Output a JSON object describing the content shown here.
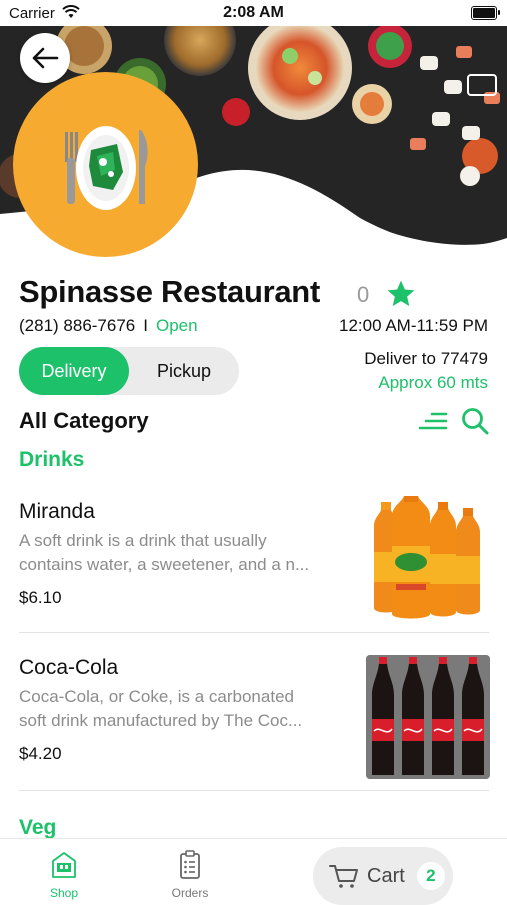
{
  "status_bar": {
    "carrier": "Carrier",
    "time": "2:08 AM"
  },
  "restaurant": {
    "name": "Spinasse Restaurant",
    "rating_count": "0",
    "phone": "(281) 886-7676",
    "separator": "I",
    "status": "Open",
    "hours": "12:00 AM-11:59 PM"
  },
  "order_mode": {
    "delivery_label": "Delivery",
    "pickup_label": "Pickup",
    "selected": "Delivery"
  },
  "delivery": {
    "deliver_to": "Deliver to 77479",
    "approx": "Approx 60 mts"
  },
  "category_header": "All Category",
  "sections": [
    {
      "title": "Drinks",
      "items": [
        {
          "name": "Miranda",
          "desc_line1": "A soft drink is a drink that usually",
          "desc_line2": "contains water, a sweetener, and a n...",
          "price": "$6.10"
        },
        {
          "name": "Coca-Cola",
          "desc_line1": "Coca-Cola, or Coke, is a carbonated",
          "desc_line2": "soft drink manufactured by The Coc...",
          "price": "$4.20"
        }
      ]
    },
    {
      "title": "Veg"
    }
  ],
  "tab_bar": {
    "shop_label": "Shop",
    "orders_label": "Orders",
    "cart_label": "Cart",
    "cart_count": "2"
  },
  "colors": {
    "accent": "#1cc16a",
    "logo_bg": "#f6ab30"
  }
}
